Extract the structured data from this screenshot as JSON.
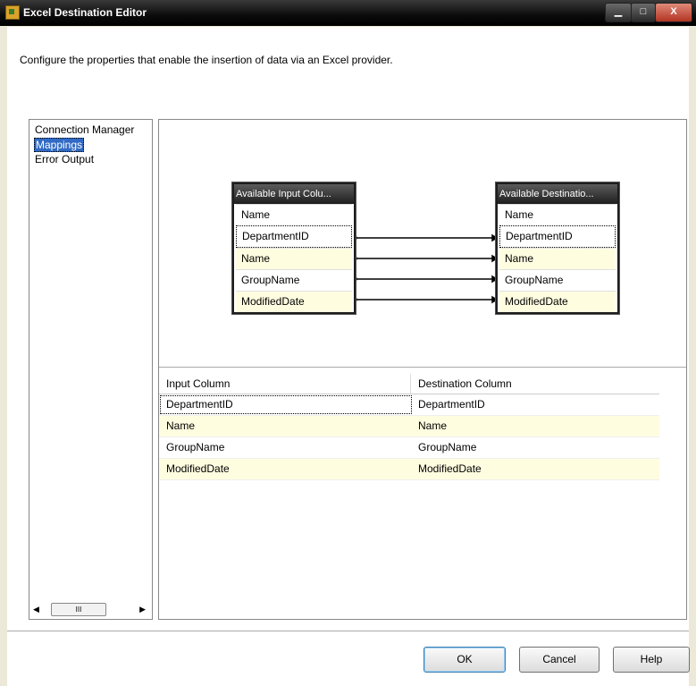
{
  "window": {
    "title": "Excel Destination Editor",
    "min_label": "▁",
    "max_label": "□",
    "close_label": "X"
  },
  "description": "Configure the properties that enable the insertion of data via an Excel provider.",
  "nav": {
    "items": [
      "Connection Manager",
      "Mappings",
      "Error Output"
    ],
    "selected": "Mappings",
    "scroll_thumb": "III",
    "scroll_left": "◀",
    "scroll_right": "▶"
  },
  "diagram": {
    "input_box": {
      "header": "Available Input Colu...",
      "rows": [
        "Name",
        "DepartmentID",
        "Name",
        "GroupName",
        "ModifiedDate"
      ]
    },
    "dest_box": {
      "header": "Available Destinatio...",
      "rows": [
        "Name",
        "DepartmentID",
        "Name",
        "GroupName",
        "ModifiedDate"
      ]
    }
  },
  "grid": {
    "headers": [
      "Input Column",
      "Destination Column"
    ],
    "rows": [
      {
        "input": "DepartmentID",
        "dest": "DepartmentID"
      },
      {
        "input": "Name",
        "dest": "Name"
      },
      {
        "input": "GroupName",
        "dest": "GroupName"
      },
      {
        "input": "ModifiedDate",
        "dest": "ModifiedDate"
      }
    ]
  },
  "buttons": {
    "ok": "OK",
    "cancel": "Cancel",
    "help": "Help"
  },
  "colors": {
    "highlight_row": "#fffde0",
    "selection": "#316ac5"
  }
}
